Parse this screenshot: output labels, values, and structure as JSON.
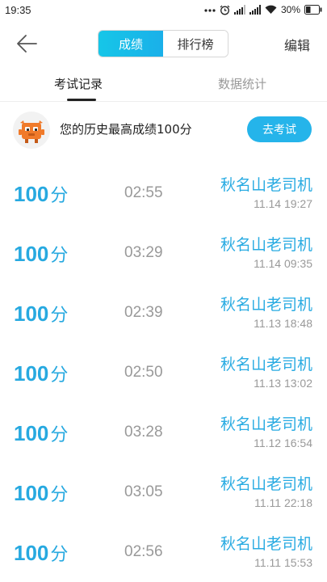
{
  "status_bar": {
    "time": "19:35",
    "battery": "30%",
    "icons": [
      "dots-icon",
      "alarm-icon",
      "signal-icon",
      "signal-icon",
      "wifi-icon",
      "battery-icon"
    ]
  },
  "header": {
    "back_icon": "arrow-left-icon",
    "segments": [
      {
        "label": "成绩",
        "active": true
      },
      {
        "label": "排行榜",
        "active": false
      }
    ],
    "edit_label": "编辑"
  },
  "tabs": [
    {
      "label": "考试记录",
      "active": true
    },
    {
      "label": "数据统计",
      "active": false
    }
  ],
  "best": {
    "text": "您的历史最高成绩100分",
    "button_label": "去考试",
    "mascot_icon": "robot-mascot-icon"
  },
  "colors": {
    "accent": "#25b4ea",
    "score": "#27a9e0",
    "muted": "#999999"
  },
  "records": [
    {
      "score": "100",
      "unit": "分",
      "duration": "02:55",
      "title": "秋名山老司机",
      "timestamp": "11.14  19:27"
    },
    {
      "score": "100",
      "unit": "分",
      "duration": "03:29",
      "title": "秋名山老司机",
      "timestamp": "11.14  09:35"
    },
    {
      "score": "100",
      "unit": "分",
      "duration": "02:39",
      "title": "秋名山老司机",
      "timestamp": "11.13  18:48"
    },
    {
      "score": "100",
      "unit": "分",
      "duration": "02:50",
      "title": "秋名山老司机",
      "timestamp": "11.13  13:02"
    },
    {
      "score": "100",
      "unit": "分",
      "duration": "03:28",
      "title": "秋名山老司机",
      "timestamp": "11.12  16:54"
    },
    {
      "score": "100",
      "unit": "分",
      "duration": "03:05",
      "title": "秋名山老司机",
      "timestamp": "11.11  22:18"
    },
    {
      "score": "100",
      "unit": "分",
      "duration": "02:56",
      "title": "秋名山老司机",
      "timestamp": "11.11  15:53"
    }
  ]
}
